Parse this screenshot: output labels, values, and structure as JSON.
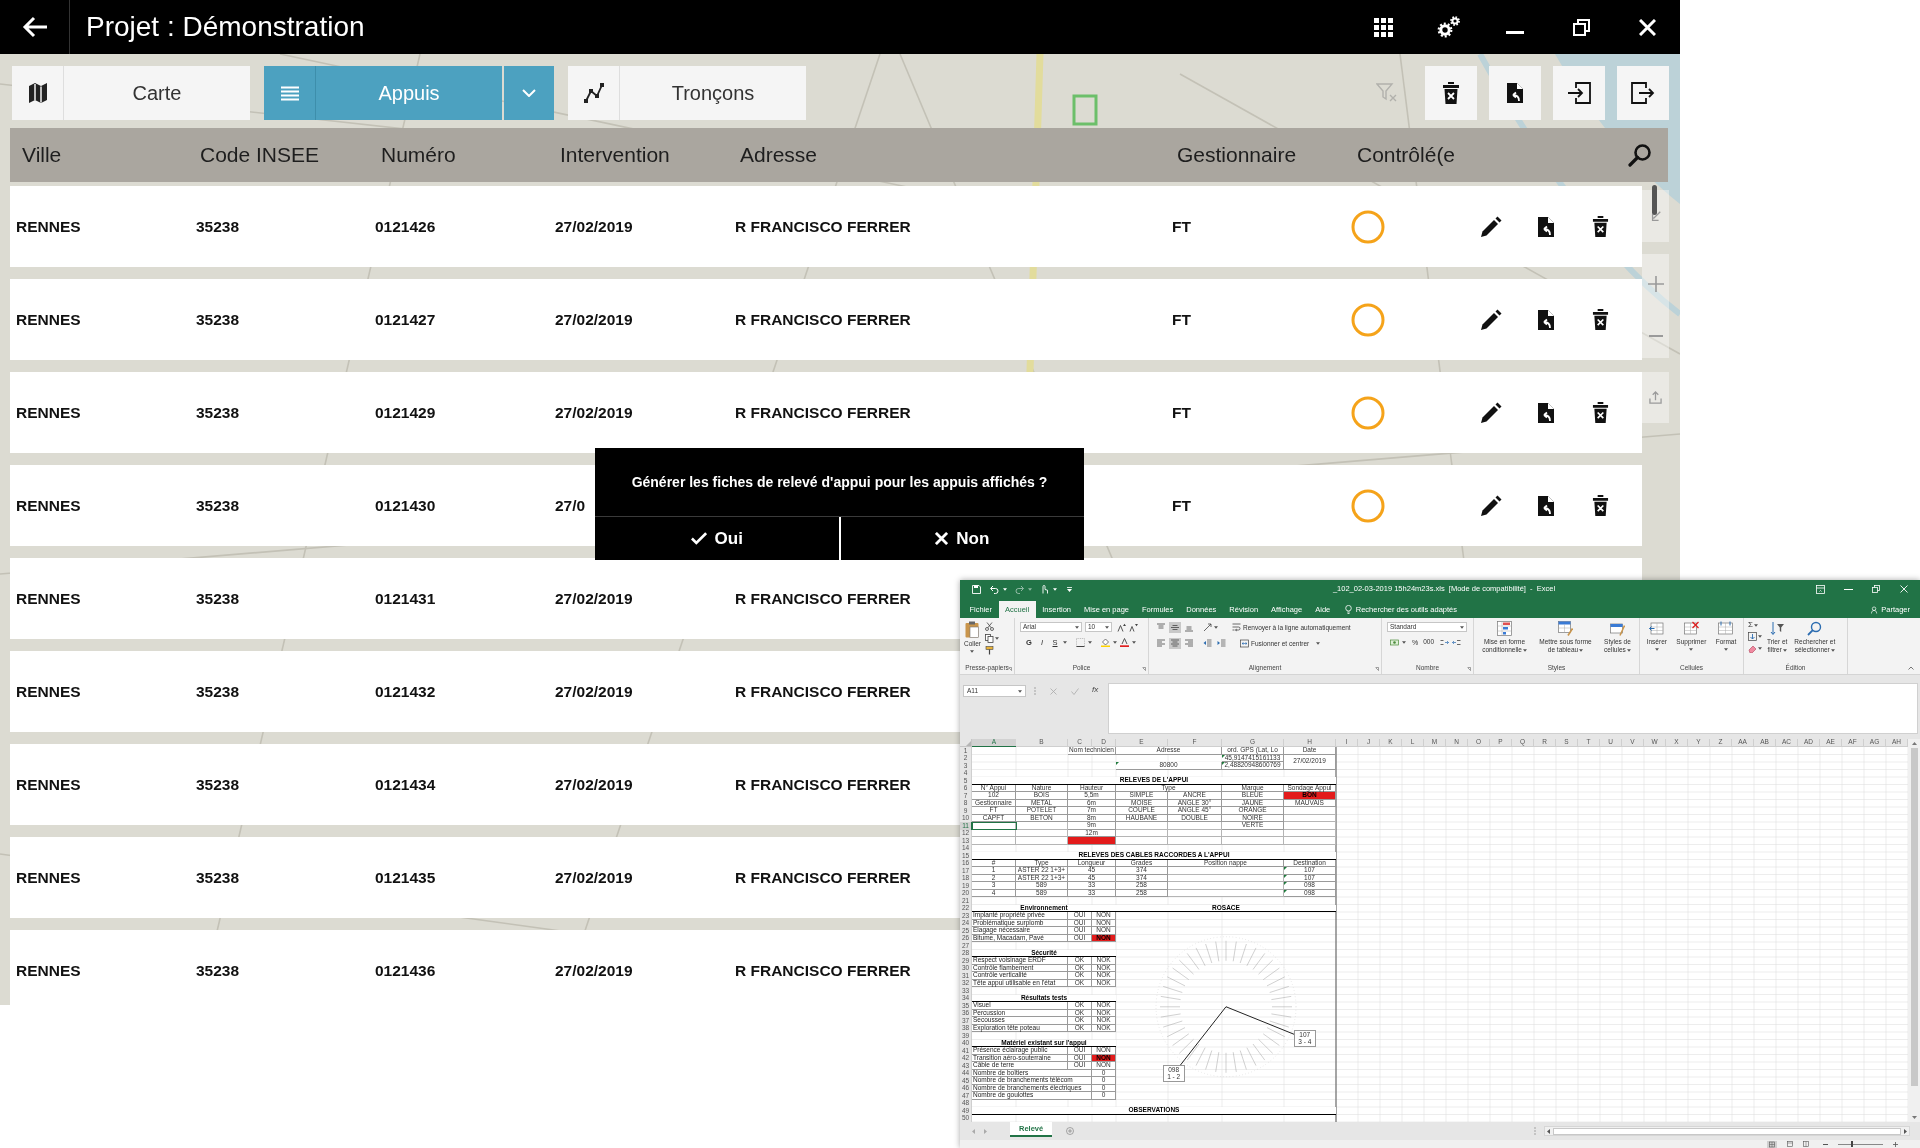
{
  "window": {
    "title": "Projet : Démonstration"
  },
  "toolbar": {
    "views": [
      {
        "label": "Carte",
        "kind": "map",
        "selected": false
      },
      {
        "label": "Appuis",
        "kind": "list",
        "selected": true,
        "dropdown": true
      },
      {
        "label": "Tronçons",
        "kind": "route",
        "selected": false
      }
    ],
    "actions": [
      {
        "kind": "filter",
        "disabled": true
      },
      {
        "kind": "clear",
        "disabled": false
      },
      {
        "kind": "export",
        "disabled": false
      },
      {
        "kind": "import",
        "disabled": false
      },
      {
        "kind": "exit",
        "disabled": false
      }
    ]
  },
  "table": {
    "columns": [
      "Ville",
      "Code INSEE",
      "Numéro",
      "Intervention",
      "Adresse",
      "Gestionnaire",
      "Contrôlé(e"
    ],
    "rows": [
      {
        "cells": [
          "RENNES",
          "35238",
          "0121426",
          "27/02/2019",
          "R FRANCISCO FERRER",
          "FT"
        ],
        "controlled": false,
        "tools": true
      },
      {
        "cells": [
          "RENNES",
          "35238",
          "0121427",
          "27/02/2019",
          "R FRANCISCO FERRER",
          "FT"
        ],
        "controlled": false,
        "tools": true
      },
      {
        "cells": [
          "RENNES",
          "35238",
          "0121429",
          "27/02/2019",
          "R FRANCISCO FERRER",
          "FT"
        ],
        "controlled": false,
        "tools": true
      },
      {
        "cells": [
          "RENNES",
          "35238",
          "0121430",
          "27/0",
          null,
          "FT"
        ],
        "controlled": false,
        "tools": true
      },
      {
        "cells": [
          "RENNES",
          "35238",
          "0121431",
          "27/02/2019",
          "R FRANCISCO FERRER"
        ]
      },
      {
        "cells": [
          "RENNES",
          "35238",
          "0121432",
          "27/02/2019",
          "R FRANCISCO FERRER"
        ]
      },
      {
        "cells": [
          "RENNES",
          "35238",
          "0121434",
          "27/02/2019",
          "R FRANCISCO FERRER"
        ]
      },
      {
        "cells": [
          "RENNES",
          "35238",
          "0121435",
          "27/02/2019",
          "R FRANCISCO FERRER"
        ]
      },
      {
        "cells": [
          "RENNES",
          "35238",
          "0121436",
          "27/02/2019",
          "R FRANCISCO FERRER"
        ]
      }
    ]
  },
  "dialog": {
    "message": "Générer les fiches de relevé d'appui pour les appuis affichés ?",
    "buttons": [
      {
        "label": "Oui",
        "kind": "confirm"
      },
      {
        "label": "Non",
        "kind": "cancel"
      }
    ]
  },
  "excel": {
    "title": "_102_02-03-2019 15h24m23s.xls  [Mode de compatibilité]  -  Excel",
    "tabs": [
      {
        "label": "Fichier",
        "selected": false
      },
      {
        "label": "Accueil",
        "selected": true
      },
      {
        "label": "Insertion",
        "selected": false
      },
      {
        "label": "Mise en page",
        "selected": false
      },
      {
        "label": "Formules",
        "selected": false
      },
      {
        "label": "Données",
        "selected": false
      },
      {
        "label": "Révision",
        "selected": false
      },
      {
        "label": "Affichage",
        "selected": false
      },
      {
        "label": "Aide",
        "selected": false
      }
    ],
    "search": {
      "placeholder": "Rechercher des outils adaptés"
    },
    "share": "Partager",
    "ribbon": {
      "clipboard": {
        "label": "Presse-papiers",
        "paste": "Coller"
      },
      "font": {
        "label": "Police",
        "font": "Arial",
        "size": "10",
        "styles": [
          "G",
          "I",
          "S"
        ]
      },
      "alignment": {
        "label": "Alignement",
        "vertical_align": [
          {
            "selected": false
          },
          {
            "selected": true
          },
          {
            "selected": false
          }
        ],
        "horizontal_align": [
          {
            "selected": false
          },
          {
            "selected": true
          },
          {
            "selected": false
          }
        ],
        "wrap": "Renvoyer à la ligne automatiquement",
        "merge": "Fusionner et centrer"
      },
      "number": {
        "label": "Nombre",
        "format": "Standard",
        "percent": "%",
        "thousands": "000"
      },
      "styles": {
        "label": "Styles",
        "commands": [
          {
            "lines": [
              "Mise en forme",
              "conditionnelle"
            ]
          },
          {
            "lines": [
              "Mettre sous forme",
              "de tableau"
            ]
          },
          {
            "lines": [
              "Styles de",
              "cellules"
            ]
          }
        ]
      },
      "cells": {
        "label": "Cellules",
        "commands": [
          {
            "lines": [
              "Insérer"
            ]
          },
          {
            "lines": [
              "Supprimer"
            ]
          },
          {
            "lines": [
              "Format"
            ]
          }
        ]
      },
      "editing": {
        "label": "Édition",
        "autosum": "Σ",
        "commands": [
          {
            "lines": [
              "Trier et",
              "filtrer"
            ]
          },
          {
            "lines": [
              "Rechercher et",
              "sélectionner"
            ]
          }
        ]
      }
    },
    "formula_bar": {
      "name_box": "A11",
      "function_label": "fx"
    },
    "sheet": {
      "columns": [
        "A",
        "B",
        "C",
        "D",
        "E",
        "F",
        "G",
        "H",
        "I",
        "J",
        "K",
        "L",
        "M",
        "N",
        "O",
        "P",
        "Q",
        "R",
        "S",
        "T",
        "U",
        "V",
        "W",
        "X",
        "Y",
        "Z",
        "AA",
        "AB",
        "AC",
        "AD",
        "AE",
        "AF",
        "AG",
        "AH"
      ],
      "rows": [
        {
          "number": "1",
          "kind": "meta1",
          "cells": [
            {
              "text": "Nom technicien",
              "kind": "header"
            },
            {
              "text": "Adresse",
              "kind": "header"
            },
            {
              "text": "ord. GPS (Lat, Lo",
              "kind": "header"
            },
            {
              "text": "Date",
              "kind": "header"
            }
          ]
        },
        {
          "number": "2",
          "kind": "meta2",
          "cells": [
            {
              "text": "45,9147415161133",
              "kind": "numtext"
            },
            {
              "text": "27/02/2019",
              "kind": "value"
            }
          ]
        },
        {
          "number": "3",
          "kind": "meta3",
          "cells": [
            {
              "text": "80800",
              "kind": "numtext"
            },
            {
              "text": "2,48820948600769",
              "kind": "numtext"
            }
          ]
        },
        {
          "number": "4"
        },
        {
          "number": "5",
          "kind": "banner",
          "cells": [
            {
              "text": "RELEVES DE L'APPUI",
              "kind": "title"
            }
          ]
        },
        {
          "number": "6",
          "kind": "pole_head",
          "cells": [
            {
              "text": "N° Appui",
              "kind": "header"
            },
            {
              "text": "Nature",
              "kind": "header"
            },
            {
              "text": "Hauteur",
              "kind": "header"
            },
            {
              "text": "Type",
              "kind": "header"
            },
            {
              "text": "Marque",
              "kind": "header"
            },
            {
              "text": "Sondage Appui",
              "kind": "header"
            }
          ]
        },
        {
          "number": "7",
          "kind": "pole",
          "cells": [
            {
              "text": "102",
              "kind": "value"
            },
            {
              "text": "BOIS",
              "kind": "value"
            },
            {
              "text": "5,5m",
              "kind": "value"
            },
            {
              "text": "SIMPLE",
              "kind": "value"
            },
            {
              "text": "ANCRE",
              "kind": "value"
            },
            {
              "text": "BLEUE",
              "kind": "value"
            },
            {
              "text": "BON",
              "kind": "alert"
            }
          ]
        },
        {
          "number": "8",
          "kind": "pole",
          "cells": [
            {
              "text": "Gestionnaire",
              "kind": "value"
            },
            {
              "text": "METAL",
              "kind": "value"
            },
            {
              "text": "6m",
              "kind": "value"
            },
            {
              "text": "MOISE",
              "kind": "value"
            },
            {
              "text": "ANGLE 30°",
              "kind": "value"
            },
            {
              "text": "JAUNE",
              "kind": "value"
            },
            {
              "text": "MAUVAIS",
              "kind": "value"
            }
          ]
        },
        {
          "number": "9",
          "kind": "pole",
          "cells": [
            {
              "text": "FT",
              "kind": "value"
            },
            {
              "text": "POTELET",
              "kind": "value"
            },
            {
              "text": "7m",
              "kind": "value"
            },
            {
              "text": "COUPLE",
              "kind": "value"
            },
            {
              "text": "ANGLE 45°",
              "kind": "value"
            },
            {
              "text": "ORANGE",
              "kind": "value"
            },
            null
          ]
        },
        {
          "number": "10",
          "kind": "pole",
          "cells": [
            {
              "text": "CAPFT",
              "kind": "value"
            },
            {
              "text": "BETON",
              "kind": "value"
            },
            {
              "text": "8m",
              "kind": "value"
            },
            {
              "text": "HAUBANE",
              "kind": "value"
            },
            {
              "text": "DOUBLE",
              "kind": "value"
            },
            {
              "text": "NOIRE",
              "kind": "value"
            },
            null
          ]
        },
        {
          "number": "11",
          "kind": "pole",
          "cells": [
            null,
            null,
            {
              "text": "9m",
              "kind": "value"
            },
            null,
            null,
            {
              "text": "VERTE",
              "kind": "value"
            },
            null
          ]
        },
        {
          "number": "12",
          "kind": "pole",
          "cells": [
            null,
            null,
            {
              "text": "12m",
              "kind": "value"
            },
            null,
            null,
            null,
            null
          ]
        },
        {
          "number": "13",
          "kind": "pole",
          "cells": [
            null,
            null,
            {
              "kind": "alert"
            },
            null,
            null,
            null,
            null
          ]
        },
        {
          "number": "14"
        },
        {
          "number": "15",
          "kind": "banner",
          "cells": [
            {
              "text": "RELEVES DES CABLES RACCORDES A L'APPUI",
              "kind": "title"
            }
          ]
        },
        {
          "number": "16",
          "kind": "cable",
          "cells": [
            {
              "text": "#",
              "kind": "header"
            },
            {
              "text": "Type",
              "kind": "header"
            },
            {
              "text": "Longueur",
              "kind": "header"
            },
            {
              "text": "Grades",
              "kind": "header"
            },
            {
              "text": "Position nappe",
              "kind": "header"
            },
            {
              "text": "Destination",
              "kind": "header"
            }
          ]
        },
        {
          "number": "17",
          "kind": "cable",
          "cells": [
            {
              "text": "1",
              "kind": "value"
            },
            {
              "text": "ASTER 22 1+3+",
              "kind": "value"
            },
            {
              "text": "45",
              "kind": "value"
            },
            {
              "text": "374",
              "kind": "value"
            },
            null,
            {
              "text": "107",
              "kind": "numtext"
            }
          ]
        },
        {
          "number": "18",
          "kind": "cable",
          "cells": [
            {
              "text": "2",
              "kind": "value"
            },
            {
              "text": "ASTER 22 1+3+",
              "kind": "value"
            },
            {
              "text": "45",
              "kind": "value"
            },
            {
              "text": "374",
              "kind": "value"
            },
            null,
            {
              "text": "107",
              "kind": "numtext"
            }
          ]
        },
        {
          "number": "19",
          "kind": "cable",
          "cells": [
            {
              "text": "3",
              "kind": "value"
            },
            {
              "text": "589",
              "kind": "value"
            },
            {
              "text": "33",
              "kind": "value"
            },
            {
              "text": "258",
              "kind": "value"
            },
            null,
            {
              "text": "098",
              "kind": "numtext"
            }
          ]
        },
        {
          "number": "20",
          "kind": "cable",
          "cells": [
            {
              "text": "4",
              "kind": "value"
            },
            {
              "text": "589",
              "kind": "value"
            },
            {
              "text": "33",
              "kind": "value"
            },
            {
              "text": "258",
              "kind": "value"
            },
            null,
            {
              "text": "098",
              "kind": "numtext"
            }
          ]
        },
        {
          "number": "21"
        },
        {
          "number": "22",
          "kind": "split",
          "cells": [
            {
              "text": "Environnement",
              "kind": "section"
            },
            {
              "text": "ROSACE",
              "kind": "section"
            }
          ]
        },
        {
          "number": "23",
          "kind": "check",
          "cells": [
            {
              "text": "Implanté propriété privée",
              "kind": "label"
            },
            {
              "text": "OUI",
              "kind": "value"
            },
            {
              "text": "NON",
              "kind": "value"
            }
          ]
        },
        {
          "number": "24",
          "kind": "check",
          "cells": [
            {
              "text": "Problématique surplomb",
              "kind": "label"
            },
            {
              "text": "OUI",
              "kind": "value"
            },
            {
              "text": "NON",
              "kind": "value"
            }
          ]
        },
        {
          "number": "25",
          "kind": "check",
          "cells": [
            {
              "text": "Elagage nécessaire",
              "kind": "label"
            },
            {
              "text": "OUI",
              "kind": "value"
            },
            {
              "text": "NON",
              "kind": "value"
            }
          ]
        },
        {
          "number": "26",
          "kind": "check",
          "cells": [
            {
              "text": "Bitume, Macadam, Pavé",
              "kind": "label"
            },
            {
              "text": "OUI",
              "kind": "value"
            },
            {
              "text": "NON",
              "kind": "alert"
            }
          ]
        },
        {
          "number": "27"
        },
        {
          "number": "28",
          "kind": "section",
          "cells": [
            {
              "text": "Sécurité",
              "kind": "section"
            }
          ]
        },
        {
          "number": "29",
          "kind": "check",
          "cells": [
            {
              "text": "Respect voisinage ERDF",
              "kind": "label"
            },
            {
              "text": "OK",
              "kind": "value"
            },
            {
              "text": "NOK",
              "kind": "value"
            }
          ]
        },
        {
          "number": "30",
          "kind": "check",
          "cells": [
            {
              "text": "Contrôle flambement",
              "kind": "label"
            },
            {
              "text": "OK",
              "kind": "value"
            },
            {
              "text": "NOK",
              "kind": "value"
            }
          ]
        },
        {
          "number": "31",
          "kind": "check",
          "cells": [
            {
              "text": "Contrôle verticalité",
              "kind": "label"
            },
            {
              "text": "OK",
              "kind": "value"
            },
            {
              "text": "NOK",
              "kind": "value"
            }
          ]
        },
        {
          "number": "32",
          "kind": "check",
          "cells": [
            {
              "text": "Tête appui utilisable en l'état",
              "kind": "label"
            },
            {
              "text": "OK",
              "kind": "value"
            },
            {
              "text": "NOK",
              "kind": "value"
            }
          ]
        },
        {
          "number": "33"
        },
        {
          "number": "34",
          "kind": "section",
          "cells": [
            {
              "text": "Résultats tests",
              "kind": "section"
            }
          ]
        },
        {
          "number": "35",
          "kind": "check",
          "cells": [
            {
              "text": "Visuel",
              "kind": "label"
            },
            {
              "text": "OK",
              "kind": "value"
            },
            {
              "text": "NOK",
              "kind": "value"
            }
          ]
        },
        {
          "number": "36",
          "kind": "check",
          "cells": [
            {
              "text": "Percussion",
              "kind": "label"
            },
            {
              "text": "OK",
              "kind": "value"
            },
            {
              "text": "NOK",
              "kind": "value"
            }
          ]
        },
        {
          "number": "37",
          "kind": "check",
          "cells": [
            {
              "text": "Secousses",
              "kind": "label"
            },
            {
              "text": "OK",
              "kind": "value"
            },
            {
              "text": "NOK",
              "kind": "value"
            }
          ]
        },
        {
          "number": "38",
          "kind": "check",
          "cells": [
            {
              "text": "Exploration tête poteau",
              "kind": "label"
            },
            {
              "text": "OK",
              "kind": "value"
            },
            {
              "text": "NOK",
              "kind": "value"
            }
          ]
        },
        {
          "number": "39"
        },
        {
          "number": "40",
          "kind": "section",
          "cells": [
            {
              "text": "Matériel existant sur l'appui",
              "kind": "section"
            }
          ]
        },
        {
          "number": "41",
          "kind": "check",
          "cells": [
            {
              "text": "Présence éclairage public",
              "kind": "label"
            },
            {
              "text": "OUI",
              "kind": "value"
            },
            {
              "text": "NON",
              "kind": "value"
            }
          ]
        },
        {
          "number": "42",
          "kind": "check",
          "cells": [
            {
              "text": "Transition aéro-souterraine",
              "kind": "label"
            },
            {
              "text": "OUI",
              "kind": "value"
            },
            {
              "text": "NON",
              "kind": "alert"
            }
          ]
        },
        {
          "number": "43",
          "kind": "check",
          "cells": [
            {
              "text": "Câble de terre",
              "kind": "label"
            },
            {
              "text": "OUI",
              "kind": "value"
            },
            {
              "text": "NON",
              "kind": "value"
            }
          ]
        },
        {
          "number": "44",
          "kind": "count",
          "cells": [
            {
              "text": "Nombre de boîtiers",
              "kind": "label"
            },
            {
              "text": "0",
              "kind": "value"
            }
          ]
        },
        {
          "number": "45",
          "kind": "count",
          "cells": [
            {
              "text": "Nombre de branchements télécom",
              "kind": "label"
            },
            {
              "text": "0",
              "kind": "value"
            }
          ]
        },
        {
          "number": "46",
          "kind": "count",
          "cells": [
            {
              "text": "Nombre de branchements électriques",
              "kind": "label"
            },
            {
              "text": "0",
              "kind": "value"
            }
          ]
        },
        {
          "number": "47",
          "kind": "count",
          "cells": [
            {
              "text": "Nombre de goulottes",
              "kind": "label"
            },
            {
              "text": "0",
              "kind": "value"
            }
          ]
        },
        {
          "number": "48"
        },
        {
          "number": "49",
          "kind": "banner",
          "cells": [
            {
              "text": "OBSERVATIONS",
              "kind": "title"
            }
          ]
        },
        {
          "number": "50"
        }
      ],
      "rosace": {
        "markers": [
          {
            "value": "098",
            "cables": "1 - 2"
          },
          {
            "value": "107",
            "cables": "3 - 4"
          }
        ]
      }
    },
    "sheet_tabs": [
      {
        "label": "Relevé",
        "selected": true
      }
    ],
    "zoom_slider": {
      "level": 0.3
    }
  }
}
